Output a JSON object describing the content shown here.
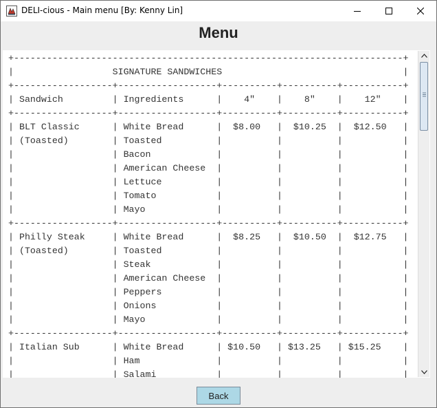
{
  "window": {
    "title": "DELI-cious - Main menu [By: Kenny Lin]",
    "icon": "java-app-icon",
    "controls": {
      "minimize": "minimize-icon",
      "maximize": "maximize-icon",
      "close": "close-icon"
    }
  },
  "header": {
    "title": "Menu"
  },
  "menu": {
    "lines": [
      "+-----------------------------------------------------------------------+",
      "|                  SIGNATURE SANDWICHES                                 |",
      "+------------------+------------------+----------+----------+-----------+",
      "| Sandwich         | Ingredients      |    4\"    |    8\"    |    12\"    |",
      "+------------------+------------------+----------+----------+-----------+",
      "| BLT Classic      | White Bread      |  $8.00   |  $10.25  |  $12.50   |",
      "| (Toasted)        | Toasted          |          |          |           |",
      "|                  | Bacon            |          |          |           |",
      "|                  | American Cheese  |          |          |           |",
      "|                  | Lettuce          |          |          |           |",
      "|                  | Tomato           |          |          |           |",
      "|                  | Mayo             |          |          |           |",
      "+------------------+------------------+----------+----------+-----------+",
      "| Philly Steak     | White Bread      |  $8.25   |  $10.50  |  $12.75   |",
      "| (Toasted)        | Toasted          |          |          |           |",
      "|                  | Steak            |          |          |           |",
      "|                  | American Cheese  |          |          |           |",
      "|                  | Peppers          |          |          |           |",
      "|                  | Onions           |          |          |           |",
      "|                  | Mayo             |          |          |           |",
      "+------------------+------------------+----------+----------+-----------+",
      "| Italian Sub      | White Bread      | $10.50   | $13.25   | $15.25    |",
      "|                  | Ham              |          |          |           |",
      "|                  | Salami           |          |          |           |"
    ]
  },
  "scrollbar": {
    "up": "scroll-up-arrow-icon",
    "down": "scroll-down-arrow-icon",
    "grip": "scroll-grip-icon"
  },
  "actions": {
    "back_label": "Back"
  },
  "colors": {
    "back_button": "#add8e6",
    "thumb": "#dde8f3"
  }
}
